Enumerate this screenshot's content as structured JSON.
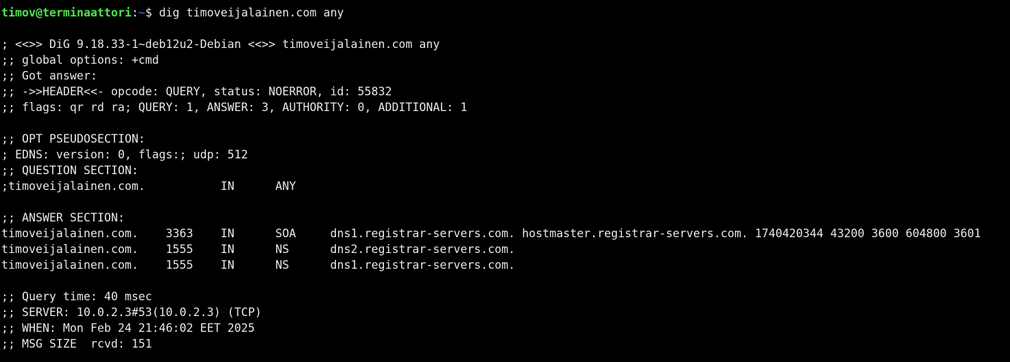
{
  "prompt": {
    "user_host": "timov@terminaattori",
    "colon": ":",
    "path": "~",
    "symbol": "$ ",
    "command": "dig timoveijalainen.com any"
  },
  "output": [
    "",
    "; <<>> DiG 9.18.33-1~deb12u2-Debian <<>> timoveijalainen.com any",
    ";; global options: +cmd",
    ";; Got answer:",
    ";; ->>HEADER<<- opcode: QUERY, status: NOERROR, id: 55832",
    ";; flags: qr rd ra; QUERY: 1, ANSWER: 3, AUTHORITY: 0, ADDITIONAL: 1",
    "",
    ";; OPT PSEUDOSECTION:",
    "; EDNS: version: 0, flags:; udp: 512",
    ";; QUESTION SECTION:",
    ";timoveijalainen.com.\t\tIN\tANY",
    "",
    ";; ANSWER SECTION:",
    "timoveijalainen.com.\t3363\tIN\tSOA\tdns1.registrar-servers.com. hostmaster.registrar-servers.com. 1740420344 43200 3600 604800 3601",
    "timoveijalainen.com.\t1555\tIN\tNS\tdns2.registrar-servers.com.",
    "timoveijalainen.com.\t1555\tIN\tNS\tdns1.registrar-servers.com.",
    "",
    ";; Query time: 40 msec",
    ";; SERVER: 10.0.2.3#53(10.0.2.3) (TCP)",
    ";; WHEN: Mon Feb 24 21:46:02 EET 2025",
    ";; MSG SIZE  rcvd: 151"
  ]
}
